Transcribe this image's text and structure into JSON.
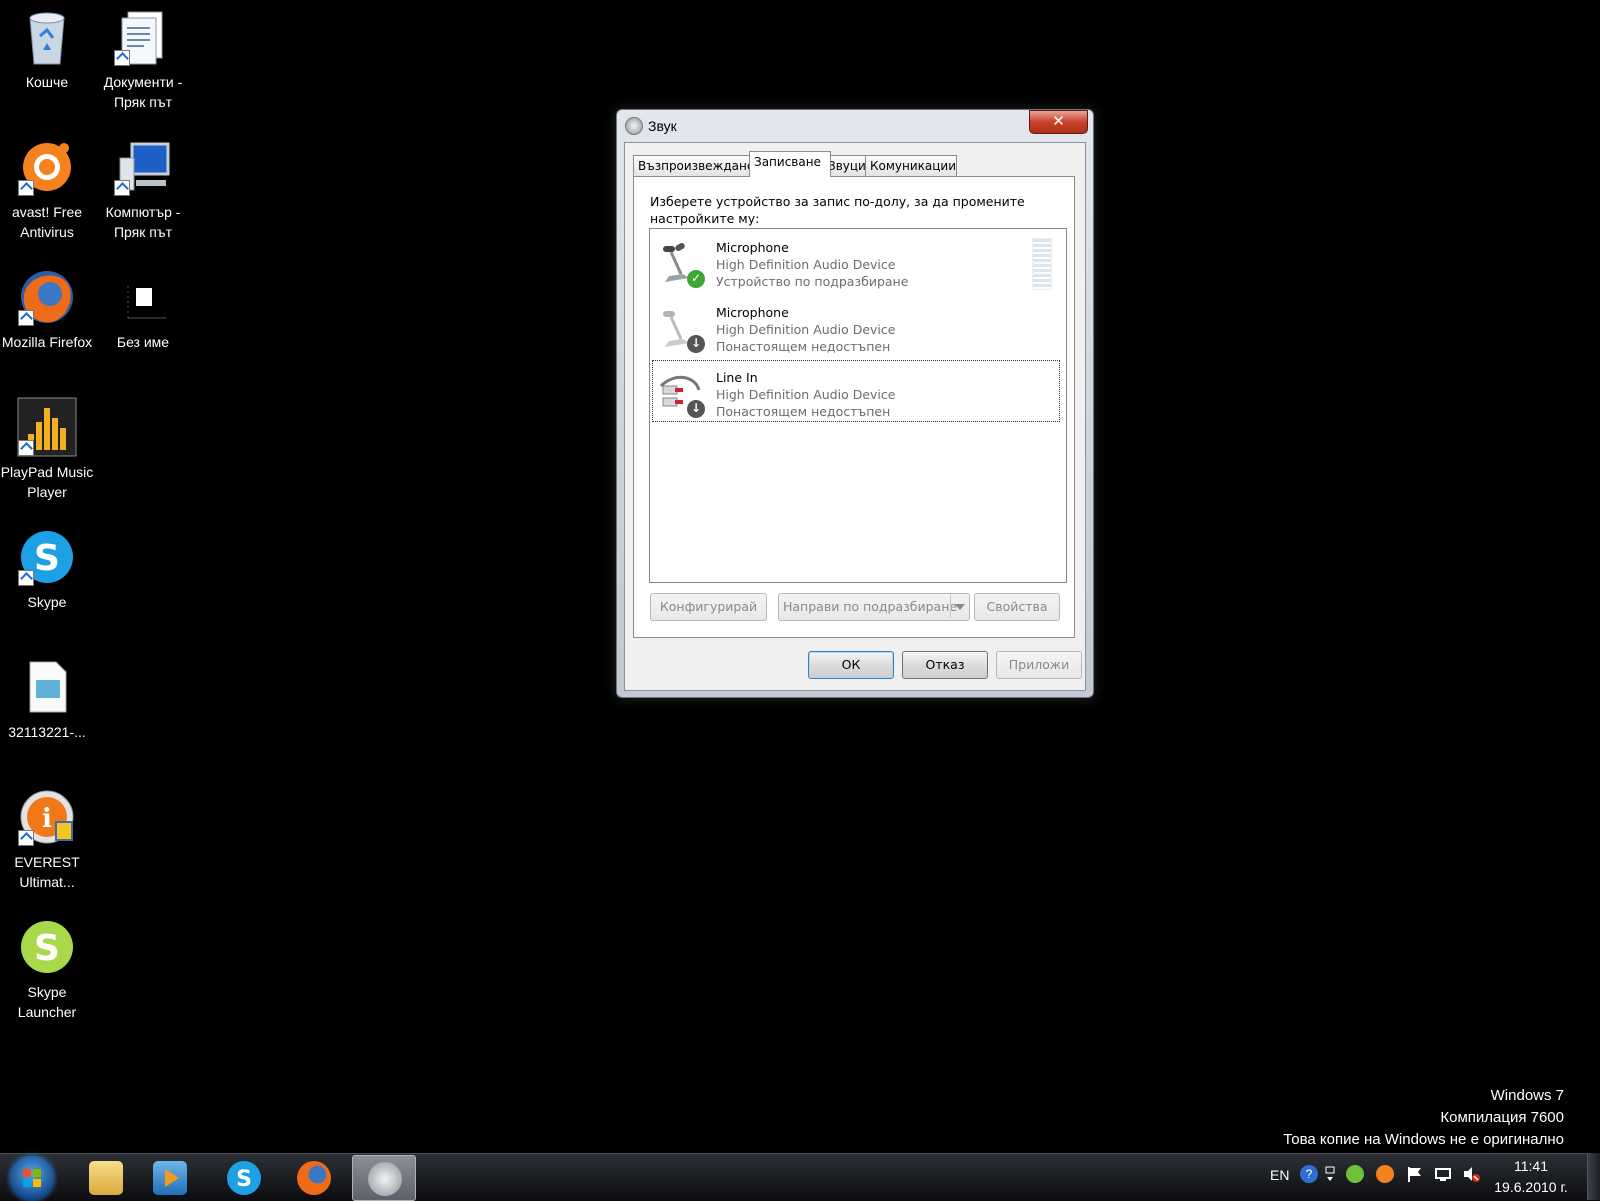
{
  "desktop": {
    "icons": [
      {
        "label": "Кошче"
      },
      {
        "label": "Документи - Пряк път"
      },
      {
        "label": "avast! Free Antivirus"
      },
      {
        "label": "Компютър - Пряк път"
      },
      {
        "label": "Mozilla Firefox"
      },
      {
        "label": "Без име"
      },
      {
        "label": "PlayPad Music Player"
      },
      {
        "label": "Skype"
      },
      {
        "label": "32113221-..."
      },
      {
        "label": "EVEREST Ultimat..."
      },
      {
        "label": "Skype Launcher"
      }
    ]
  },
  "watermark": {
    "line1": "Windows 7",
    "line2": "Компилация 7600",
    "line3": "Това копие на Windows не е оригинално"
  },
  "dialog": {
    "title": "Звук",
    "close_label": "✕",
    "tabs": [
      {
        "label": "Възпроизвеждане",
        "selected": false
      },
      {
        "label": "Записване",
        "selected": true
      },
      {
        "label": "Звуци",
        "selected": false
      },
      {
        "label": "Комуникации",
        "selected": false
      }
    ],
    "instruction": "Изберете устройство за запис по-долу, за да промените настройките му:",
    "devices": [
      {
        "name": "Microphone",
        "driver": "High Definition Audio Device",
        "status": "Устройство по подразбиране",
        "icon": "microphone-icon",
        "badge": "default-check"
      },
      {
        "name": "Microphone",
        "driver": "High Definition Audio Device",
        "status": "Понастоящем недостъпен",
        "icon": "microphone-icon",
        "badge": "unavailable-arrow"
      },
      {
        "name": "Line In",
        "driver": "High Definition Audio Device",
        "status": "Понастоящем недостъпен",
        "icon": "line-in-cable-icon",
        "badge": "unavailable-arrow"
      }
    ],
    "buttons": {
      "configure": "Конфигурирай",
      "set_default": "Направи по подразбиране",
      "properties": "Свойства",
      "ok": "ОК",
      "cancel": "Отказ",
      "apply": "Приложи"
    }
  },
  "taskbar": {
    "items": [
      "start-orb",
      "windows-explorer",
      "windows-media-player",
      "skype",
      "mozilla-firefox",
      "sound-dialog"
    ],
    "language": "EN",
    "time": "11:41",
    "date": "19.6.2010 г."
  },
  "colors": {
    "desktop_bg": "#000000",
    "accent": "#3c7fb1",
    "close_red": "#c7432b",
    "check_green": "#3fa535"
  }
}
